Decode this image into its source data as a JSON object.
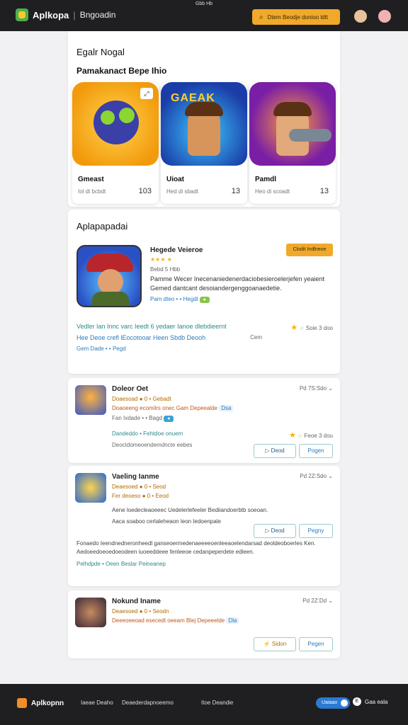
{
  "status_bar": {
    "text": "Gbb Hb"
  },
  "header": {
    "logo": "Aplkopa",
    "subtitle": "Bngoadin",
    "search_placeholder": "Dtem Beodje donioo ldtt"
  },
  "section1": {
    "title": "Egalr Nogal",
    "subtitle": "Pamakanact Bepe Ihio",
    "tiles": [
      {
        "name": "Gmeast",
        "meta": "Iol dt bcbdt",
        "count": "103",
        "art_label": ""
      },
      {
        "name": "Uioat",
        "meta": "Hed di sbadt",
        "count": "13",
        "art_label": "GAEAK"
      },
      {
        "name": "Pamdl",
        "meta": "Heo di scoadt",
        "count": "13",
        "art_label": ""
      }
    ]
  },
  "featured": {
    "section_title": "Aplapapadai",
    "title": "Hegede Veieroe",
    "stars": "★★★ ★",
    "meta": "Bebd 5 Hbb",
    "description": "Pamme Wecer Inecenaniedenerdaciobesieroelerjefen yeaient Gemed dantcant desoiandergenggoanaedetie.",
    "links": "Pam dteo • • Hegdl",
    "badge_btn": "Clodit Indlneoe",
    "row1_text": "Vedler Ian  Innc varc Ieedt 6  yedaer Ianoe dlebdieernt",
    "row1_right": "Soie 3 doo",
    "row2_text": "Hee Deoe crefl lEocotooar Heen Sbdb Deooh",
    "row2_right": "Cem",
    "row3_text": "Gem Dade • • Pegd"
  },
  "list_items": [
    {
      "title": "Doleor Oet",
      "r1": "Doaesoad  ● 0 • Gebadt",
      "r2": "Doaoeeng ecomilrs onec Gam Depeealde",
      "r2_tag": "Dsa",
      "r3": "Fan Ixdade • • Bagd",
      "side": "Pd  7S:Sdo",
      "extra1": "Dandeddo • Fehtdoe onuem",
      "extra2": "Deoctdomeoendemdncte eebes",
      "extra_right": "Feoe 3 dou",
      "btn_secondary": "Deod",
      "btn_primary": "Pogen"
    },
    {
      "title": "Vaeling Ianme",
      "r1": "Deaesoed  ● 0 • Seod",
      "r2": "Fer deoeso ● 0 • Eeod",
      "r3_line1": "Aene loedecleaoeeec Uedelerlefeeler Bediiandoerbtb soeoan.",
      "r3_line2": "Aaca soaboo cerlaleheaon leon Iedoenpale",
      "side": "Pd  2Z:Sdo",
      "btn_secondary": "Deod",
      "btn_primary": "Pegny",
      "para": "Fonaedo Ieendnedneronheedl ganseoermedenaeeeeoenleeaoelendarsad deoldeoboerles Ken. Aedoeedoeoedoeodeen iuoeeddeee fenleeoe cedanpeperdete edleen.",
      "para_links": "Pelhdpde • Oeen Beslar Peineanep"
    },
    {
      "title": "Nokund Iname",
      "r1": "Deaesoed  ● 0 • Seodn",
      "r2": "Deeeoeeoad esecedt oeeam Blej Depeeelde",
      "r2_tag": "Dla",
      "side": "Pd  2Z:Dd",
      "btn_secondary": "Sidon",
      "btn_primary": "Pegen"
    }
  ],
  "footer": {
    "logo": "Aplkopnn",
    "link1": "Iaeae Deaho",
    "link2": "Deaederdapnoeemo",
    "link3": "Itoe Deandie",
    "btn_label": "Uaiaao",
    "user_label": "Gaa eala",
    "user_initial": "E"
  },
  "colors": {
    "accent": "#f0a92a",
    "dark": "#1f1f22",
    "link": "#2b7bbd",
    "bg": "#f1f1f3"
  }
}
